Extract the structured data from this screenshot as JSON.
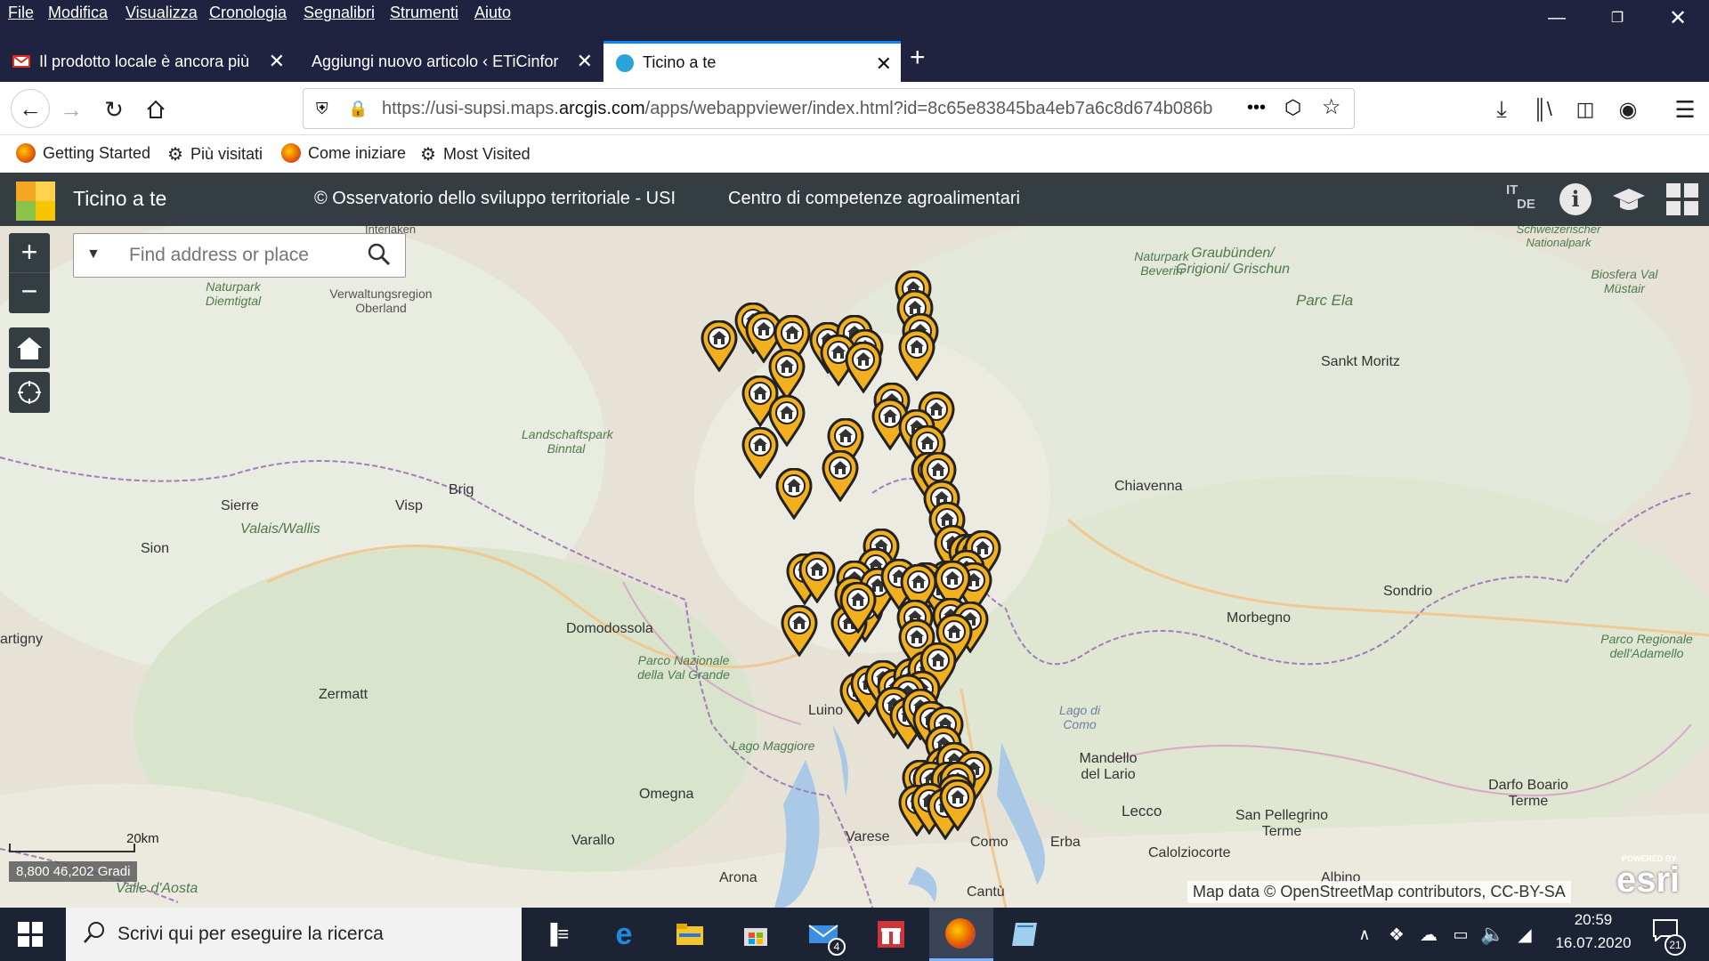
{
  "browser": {
    "menu": [
      "File",
      "Modifica",
      "Visualizza",
      "Cronologia",
      "Segnalibri",
      "Strumenti",
      "Aiuto"
    ],
    "tabs": [
      {
        "title": "Il prodotto locale è ancora più",
        "icon": "gmail-icon"
      },
      {
        "title": "Aggiungi nuovo articolo ‹ ETiCinfor",
        "icon": "none"
      },
      {
        "title": "Ticino a te",
        "icon": "arcgis-icon"
      }
    ],
    "url": {
      "prefix": "https://usi-supsi.maps.",
      "domain": "arcgis.com",
      "path": "/apps/webappviewer/index.html?id=8c65e83845ba4eb7a6c8d674b086b"
    },
    "url_more": "•••",
    "bookmarks": [
      "Getting Started",
      "Più visitati",
      "Come iniziare",
      "Most Visited"
    ]
  },
  "app": {
    "title": "Ticino a te",
    "credit": "© Osservatorio dello sviluppo territoriale - USI",
    "subtitle": "Centro di competenze agroalimentari",
    "lang_top": "IT",
    "lang_bottom": "DE",
    "search_placeholder": "Find address or place",
    "scale_label": "20km",
    "coords": "8,800 46,202 Gradi",
    "attribution": "Map data © OpenStreetMap contributors, CC-BY-SA",
    "powered_by": "POWERED BY",
    "esri": "esri"
  },
  "map_labels": [
    {
      "text": "Interlaken",
      "type": "city"
    },
    {
      "text": "Naturpark Diemtigtal",
      "type": "it"
    },
    {
      "text": "Verwaltungsregion Oberland",
      "type": "city"
    },
    {
      "text": "Landschaftspark Binntal",
      "type": "it"
    },
    {
      "text": "Brig",
      "type": "city"
    },
    {
      "text": "Visp",
      "type": "city"
    },
    {
      "text": "Sierre",
      "type": "city"
    },
    {
      "text": "Valais/Wallis",
      "type": "it"
    },
    {
      "text": "Sion",
      "type": "city"
    },
    {
      "text": "Domodossola",
      "type": "city"
    },
    {
      "text": "Parco Nazionale della Val Grande",
      "type": "it"
    },
    {
      "text": "Zermatt",
      "type": "city"
    },
    {
      "text": "Lago Maggiore",
      "type": "it"
    },
    {
      "text": "Omegna",
      "type": "city"
    },
    {
      "text": "Varallo",
      "type": "city"
    },
    {
      "text": "Varese",
      "type": "city"
    },
    {
      "text": "Arona",
      "type": "city"
    },
    {
      "text": "Como",
      "type": "city"
    },
    {
      "text": "Erba",
      "type": "city"
    },
    {
      "text": "Cantù",
      "type": "city"
    },
    {
      "text": "Lecco",
      "type": "city"
    },
    {
      "text": "Mandello del Lario",
      "type": "city"
    },
    {
      "text": "Calolziocorte",
      "type": "city"
    },
    {
      "text": "San Pellegrino Terme",
      "type": "city"
    },
    {
      "text": "Darfo Boario Terme",
      "type": "city"
    },
    {
      "text": "Albino",
      "type": "city"
    },
    {
      "text": "Morbegno",
      "type": "city"
    },
    {
      "text": "Sondrio",
      "type": "city"
    },
    {
      "text": "Chiavenna",
      "type": "city"
    },
    {
      "text": "Parco Regionale dell'Adamello",
      "type": "it"
    },
    {
      "text": "Sankt Moritz",
      "type": "city"
    },
    {
      "text": "Parc Ela",
      "type": "it"
    },
    {
      "text": "Graubünden/ Grigioni/ Grischun",
      "type": "it"
    },
    {
      "text": "Naturpark Beverin",
      "type": "it"
    },
    {
      "text": "Schweizerischer Nationalpark",
      "type": "it"
    },
    {
      "text": "Biosfera Val Müstair",
      "type": "it"
    },
    {
      "text": "Valle d'Aosta",
      "type": "it"
    },
    {
      "text": "artigny",
      "type": "city"
    },
    {
      "text": "Lago di Como",
      "type": "it"
    },
    {
      "text": "Luino",
      "type": "city"
    }
  ],
  "taskbar": {
    "search_placeholder": "Scrivi qui per eseguire la ricerca",
    "mail_badge": "4",
    "time": "20:59",
    "date": "16.07.2020",
    "notif_badge": "21"
  }
}
